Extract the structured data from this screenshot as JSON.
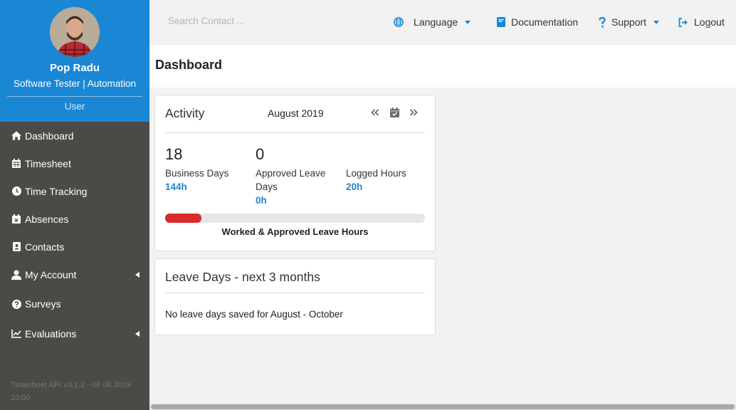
{
  "profile": {
    "name": "Pop Radu",
    "role": "Software Tester | Automation",
    "level": "User"
  },
  "sidebar": {
    "items": [
      {
        "label": "Dashboard",
        "icon": "home-icon"
      },
      {
        "label": "Timesheet",
        "icon": "calendar-icon"
      },
      {
        "label": "Time Tracking",
        "icon": "clock-icon"
      },
      {
        "label": "Absences",
        "icon": "calendar-x-icon"
      },
      {
        "label": "Contacts",
        "icon": "contact-card-icon"
      },
      {
        "label": "My Account",
        "icon": "user-icon"
      },
      {
        "label": "Surveys",
        "icon": "question-circle-icon"
      },
      {
        "label": "Evaluations",
        "icon": "line-chart-icon"
      }
    ],
    "footer": "Timesheet API v3.1.2 - 06.08.2019 10:00"
  },
  "topbar": {
    "search_placeholder": "Search Contact ...",
    "language": "Language",
    "documentation": "Documentation",
    "support": "Support",
    "logout": "Logout"
  },
  "page": {
    "title": "Dashboard"
  },
  "activity": {
    "title": "Activity",
    "month": "August 2019",
    "business_days": {
      "count": "18",
      "label": "Business Days",
      "hours": "144h"
    },
    "approved_leave": {
      "count": "0",
      "label": "Approved Leave Days",
      "hours": "0h"
    },
    "logged": {
      "label": "Logged Hours",
      "hours": "20h"
    },
    "progress_fraction": 0.14,
    "progress_caption": "Worked & Approved Leave Hours"
  },
  "leave": {
    "title": "Leave Days - next 3 months",
    "message": "No leave days saved for  August - October"
  },
  "colors": {
    "accent": "#1a87d5",
    "sidebar": "#4a4a47",
    "progress": "#d82b2b"
  }
}
